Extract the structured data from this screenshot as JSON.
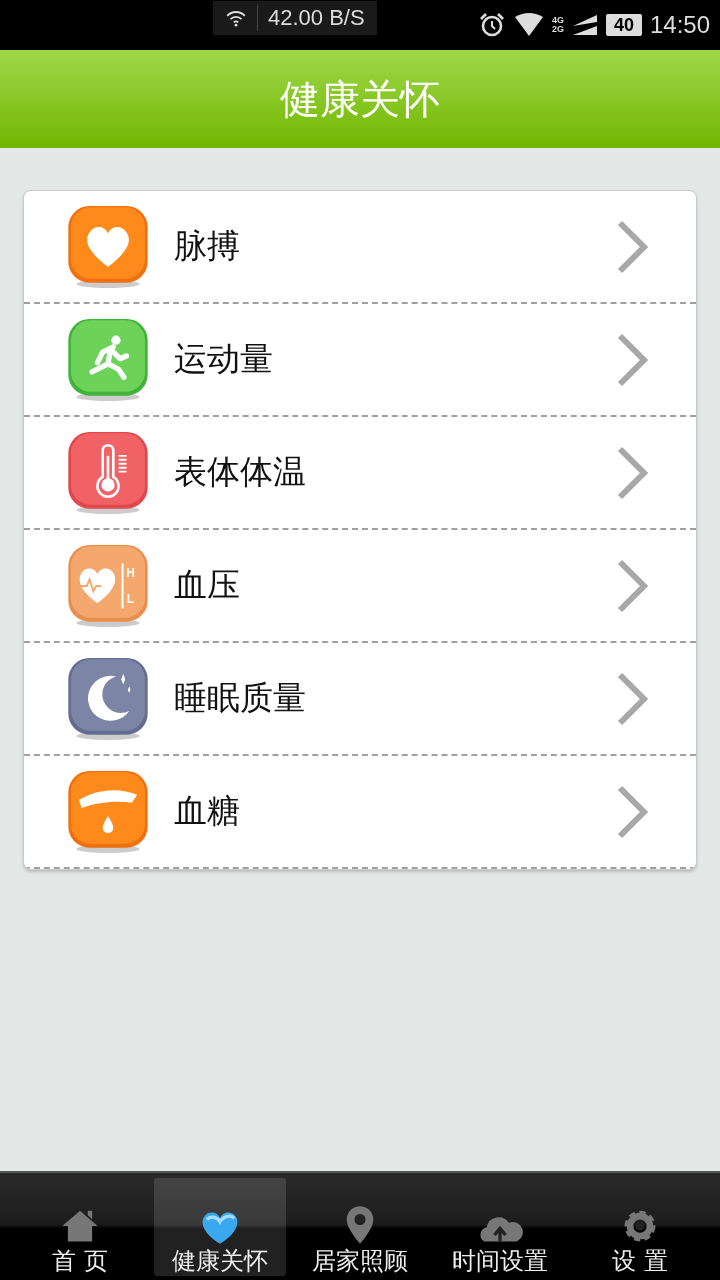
{
  "status_bar": {
    "speed": "42.00 B/S",
    "network": [
      "4G",
      "2G"
    ],
    "battery": "40",
    "time": "14:50"
  },
  "header": {
    "title": "健康关怀"
  },
  "items": [
    {
      "kind": "heart",
      "label": "脉搏"
    },
    {
      "kind": "runner",
      "label": "运动量"
    },
    {
      "kind": "thermometer",
      "label": "表体体温"
    },
    {
      "kind": "pressure",
      "label": "血压",
      "icon_labels": [
        "H",
        "L"
      ]
    },
    {
      "kind": "moon",
      "label": "睡眠质量"
    },
    {
      "kind": "drop",
      "label": "血糖"
    }
  ],
  "tabs": [
    {
      "kind": "home",
      "label": "首 页",
      "selected": false
    },
    {
      "kind": "heart",
      "label": "健康关怀",
      "selected": true
    },
    {
      "kind": "pin",
      "label": "居家照顾",
      "selected": false
    },
    {
      "kind": "cloud",
      "label": "时间设置",
      "selected": false
    },
    {
      "kind": "gear",
      "label": "设 置",
      "selected": false
    }
  ]
}
